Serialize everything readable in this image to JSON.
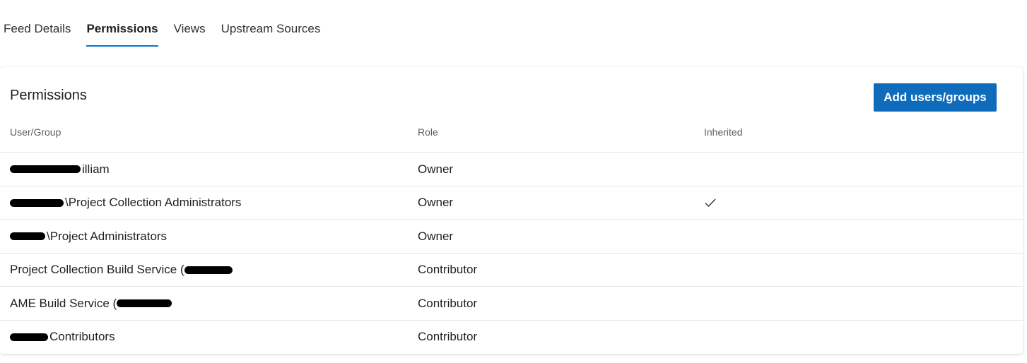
{
  "tabs": [
    {
      "label": "Feed Details",
      "active": false
    },
    {
      "label": "Permissions",
      "active": true
    },
    {
      "label": "Views",
      "active": false
    },
    {
      "label": "Upstream Sources",
      "active": false
    }
  ],
  "permissions": {
    "title": "Permissions",
    "add_button_label": "Add users/groups",
    "columns": {
      "user_group": "User/Group",
      "role": "Role",
      "inherited": "Inherited"
    },
    "rows": [
      {
        "user": "illiam",
        "role": "Owner",
        "inherited": false
      },
      {
        "user": "\\Project Collection Administrators",
        "role": "Owner",
        "inherited": true
      },
      {
        "user": "\\Project Administrators",
        "role": "Owner",
        "inherited": false
      },
      {
        "user": "Project Collection Build Service (",
        "role": "Contributor",
        "inherited": false
      },
      {
        "user": "AME Build Service (",
        "role": "Contributor",
        "inherited": false
      },
      {
        "user": "Contributors",
        "role": "Contributor",
        "inherited": false
      }
    ]
  },
  "colors": {
    "accent": "#0f6cbd",
    "tab_underline": "#0078d4"
  }
}
